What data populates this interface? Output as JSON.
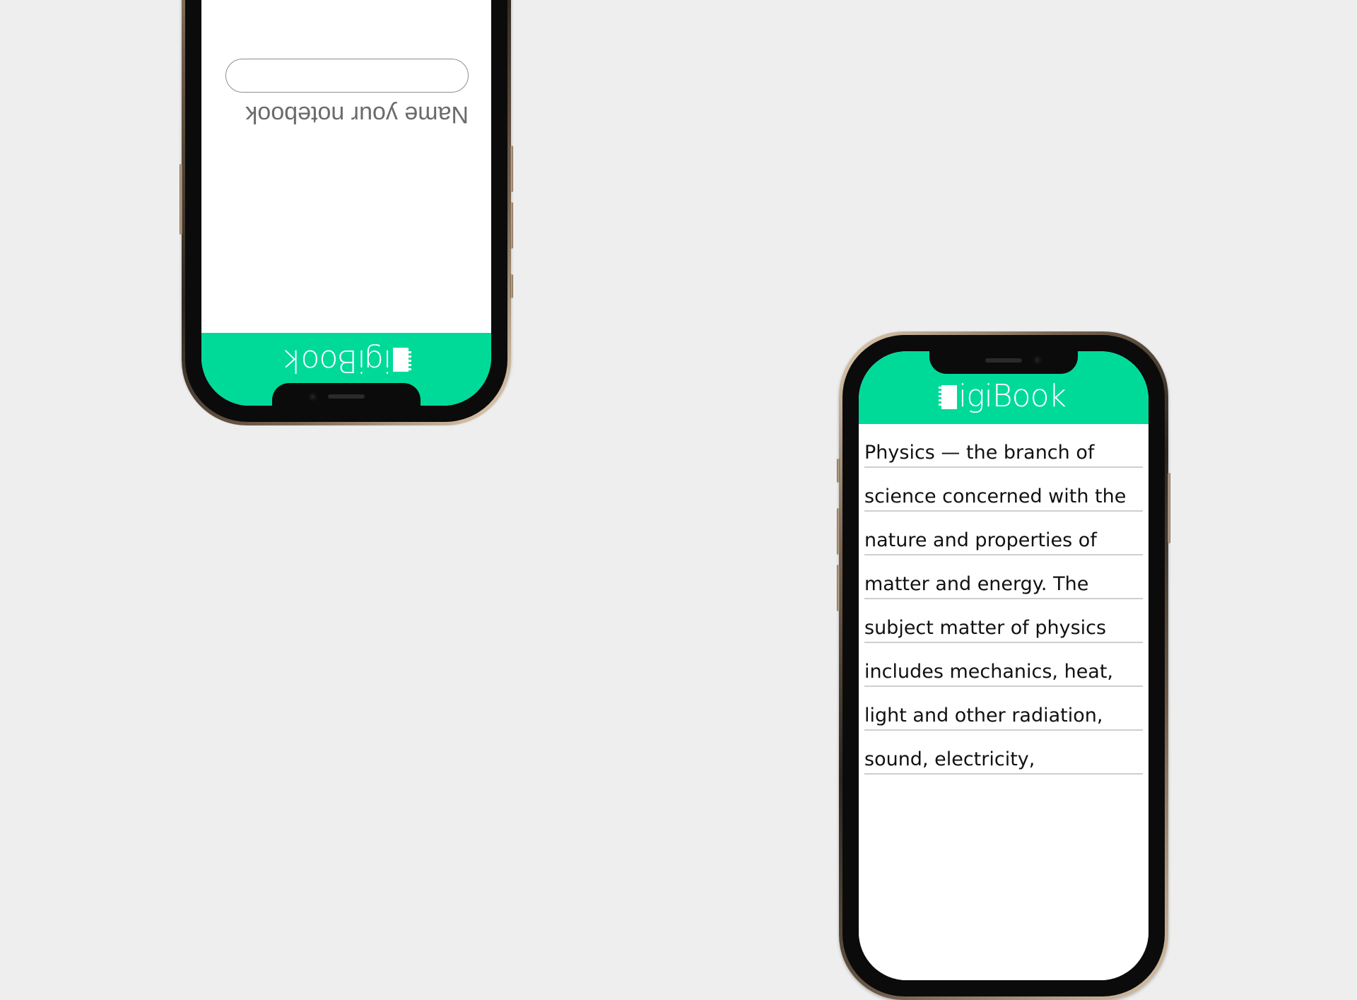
{
  "brand": {
    "name_text": "igiBook",
    "accent_color": "#00da99",
    "background_color": "#eeeeee"
  },
  "setup_screen": {
    "label": "Name your notebook",
    "input_value": "",
    "orientation": "upside-down"
  },
  "notebook_screen": {
    "lines": [
      "Physics — the branch of",
      "science concerned with the",
      "nature and properties of",
      "matter and energy. The",
      "subject matter of physics",
      "includes mechanics, heat,",
      "light and other radiation,",
      "sound, electricity,"
    ]
  },
  "icons": {
    "logo": "notebook-spiral-icon"
  }
}
